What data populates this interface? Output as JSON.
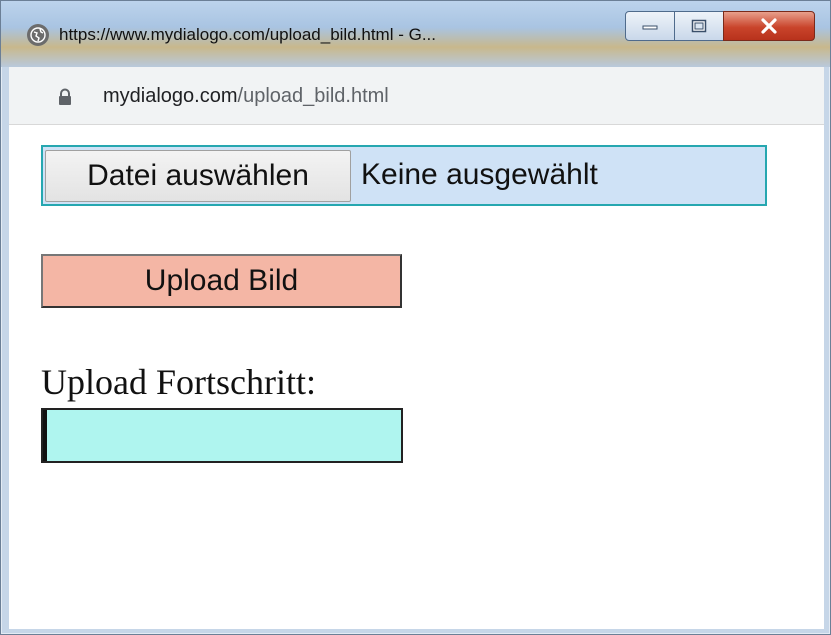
{
  "window": {
    "title": "https://www.mydialogo.com/upload_bild.html - G...",
    "site_icon": "globe-icon",
    "controls": {
      "minimize_icon": "minimize-icon",
      "maximize_icon": "maximize-icon",
      "close_icon": "close-icon"
    }
  },
  "address_bar": {
    "lock_icon": "lock-icon",
    "domain": "mydialogo.com",
    "path": "/upload_bild.html"
  },
  "form": {
    "file_button_label": "Datei auswählen",
    "file_status": "Keine ausgewählt",
    "upload_button_label": "Upload Bild",
    "progress_label": "Upload Fortschritt:",
    "progress_value": 0.01
  },
  "colors": {
    "file_input_bg": "#cfe2f6",
    "file_input_border": "#26a7b0",
    "upload_button_bg": "#f4b6a5",
    "progress_bg": "#aff5ef",
    "close_button": "#c9442b"
  }
}
